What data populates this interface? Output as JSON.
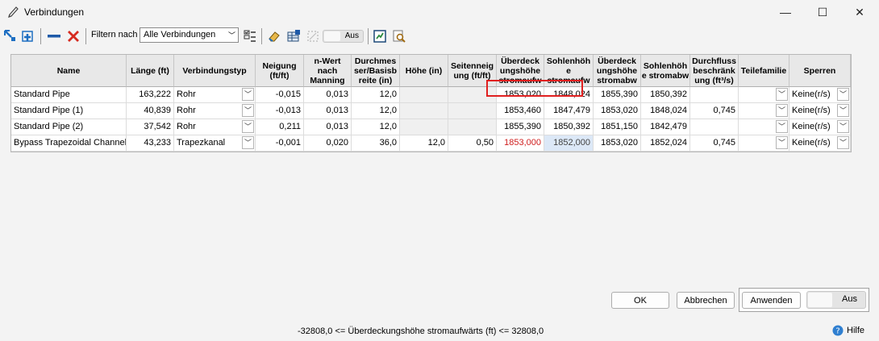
{
  "window": {
    "title": "Verbindungen",
    "minimize": "—",
    "maximize": "☐",
    "close": "✕"
  },
  "toolbar": {
    "filter_label": "Filtern nach",
    "filter_value": "Alle Verbindungen",
    "toggle_label": "Aus",
    "icons": [
      "zoom-to-icon",
      "add-connection-icon",
      "remove-icon",
      "delete-icon",
      "select-columns-icon",
      "eraser-icon",
      "table-edit-icon",
      "disabled-icon",
      "toggle",
      "report-icon",
      "find-icon"
    ]
  },
  "grid": {
    "headers": {
      "name": "Name",
      "length": "Länge (ft)",
      "type": "Verbindungstyp",
      "slope": "Neigung (ft/ft)",
      "manning": "n-Wert nach Manning",
      "diameter": "Durchmes ser/Basisb reite (in)",
      "height": "Höhe (in)",
      "sideslope": "Seitenneig ung (ft/ft)",
      "cover_up": "Überdeck ungshöhe stromaufw",
      "invert_up": "Sohlenhöh e stromaufw",
      "cover_down": "Überdeck ungshöhe stromabw",
      "invert_down": "Sohlenhöh e stromabw",
      "flow_limit": "Durchfluss beschränk ung (ft³/s)",
      "part_family": "Teilefamilie",
      "lock": "Sperren"
    },
    "rows": [
      {
        "name": "Standard Pipe",
        "length": "163,222",
        "type": "Rohr",
        "slope": "-0,015",
        "manning": "0,013",
        "diameter": "12,0",
        "height": "",
        "sideslope": "",
        "cover_up": "1853,020",
        "invert_up": "1848,024",
        "cover_down": "1855,390",
        "invert_down": "1850,392",
        "flow_limit": "",
        "part_family": "",
        "lock": "Keine(r/s)"
      },
      {
        "name": "Standard Pipe (1)",
        "length": "40,839",
        "type": "Rohr",
        "slope": "-0,013",
        "manning": "0,013",
        "diameter": "12,0",
        "height": "",
        "sideslope": "",
        "cover_up": "1853,460",
        "invert_up": "1847,479",
        "cover_down": "1853,020",
        "invert_down": "1848,024",
        "flow_limit": "0,745",
        "part_family": "",
        "lock": "Keine(r/s)"
      },
      {
        "name": "Standard Pipe (2)",
        "length": "37,542",
        "type": "Rohr",
        "slope": "0,211",
        "manning": "0,013",
        "diameter": "12,0",
        "height": "",
        "sideslope": "",
        "cover_up": "1855,390",
        "invert_up": "1850,392",
        "cover_down": "1851,150",
        "invert_down": "1842,479",
        "flow_limit": "",
        "part_family": "",
        "lock": "Keine(r/s)"
      },
      {
        "name": "Bypass Trapezoidal Channel",
        "length": "43,233",
        "type": "Trapezkanal",
        "slope": "-0,001",
        "manning": "0,020",
        "diameter": "36,0",
        "height": "12,0",
        "sideslope": "0,50",
        "cover_up": "1853,000",
        "invert_up": "1852,000",
        "cover_down": "1853,020",
        "invert_down": "1852,024",
        "flow_limit": "0,745",
        "part_family": "",
        "lock": "Keine(r/s)"
      }
    ]
  },
  "buttons": {
    "ok": "OK",
    "cancel": "Abbrechen",
    "apply": "Anwenden",
    "apply_toggle": "Aus"
  },
  "status": {
    "message": "-32808,0 <= Überdeckungshöhe stromaufwärts (ft) <= 32808,0"
  },
  "help": {
    "label": "Hilfe"
  },
  "colors": {
    "error": "#d02020",
    "selection": "#dce8f7",
    "highlight_border": "#e02020"
  }
}
